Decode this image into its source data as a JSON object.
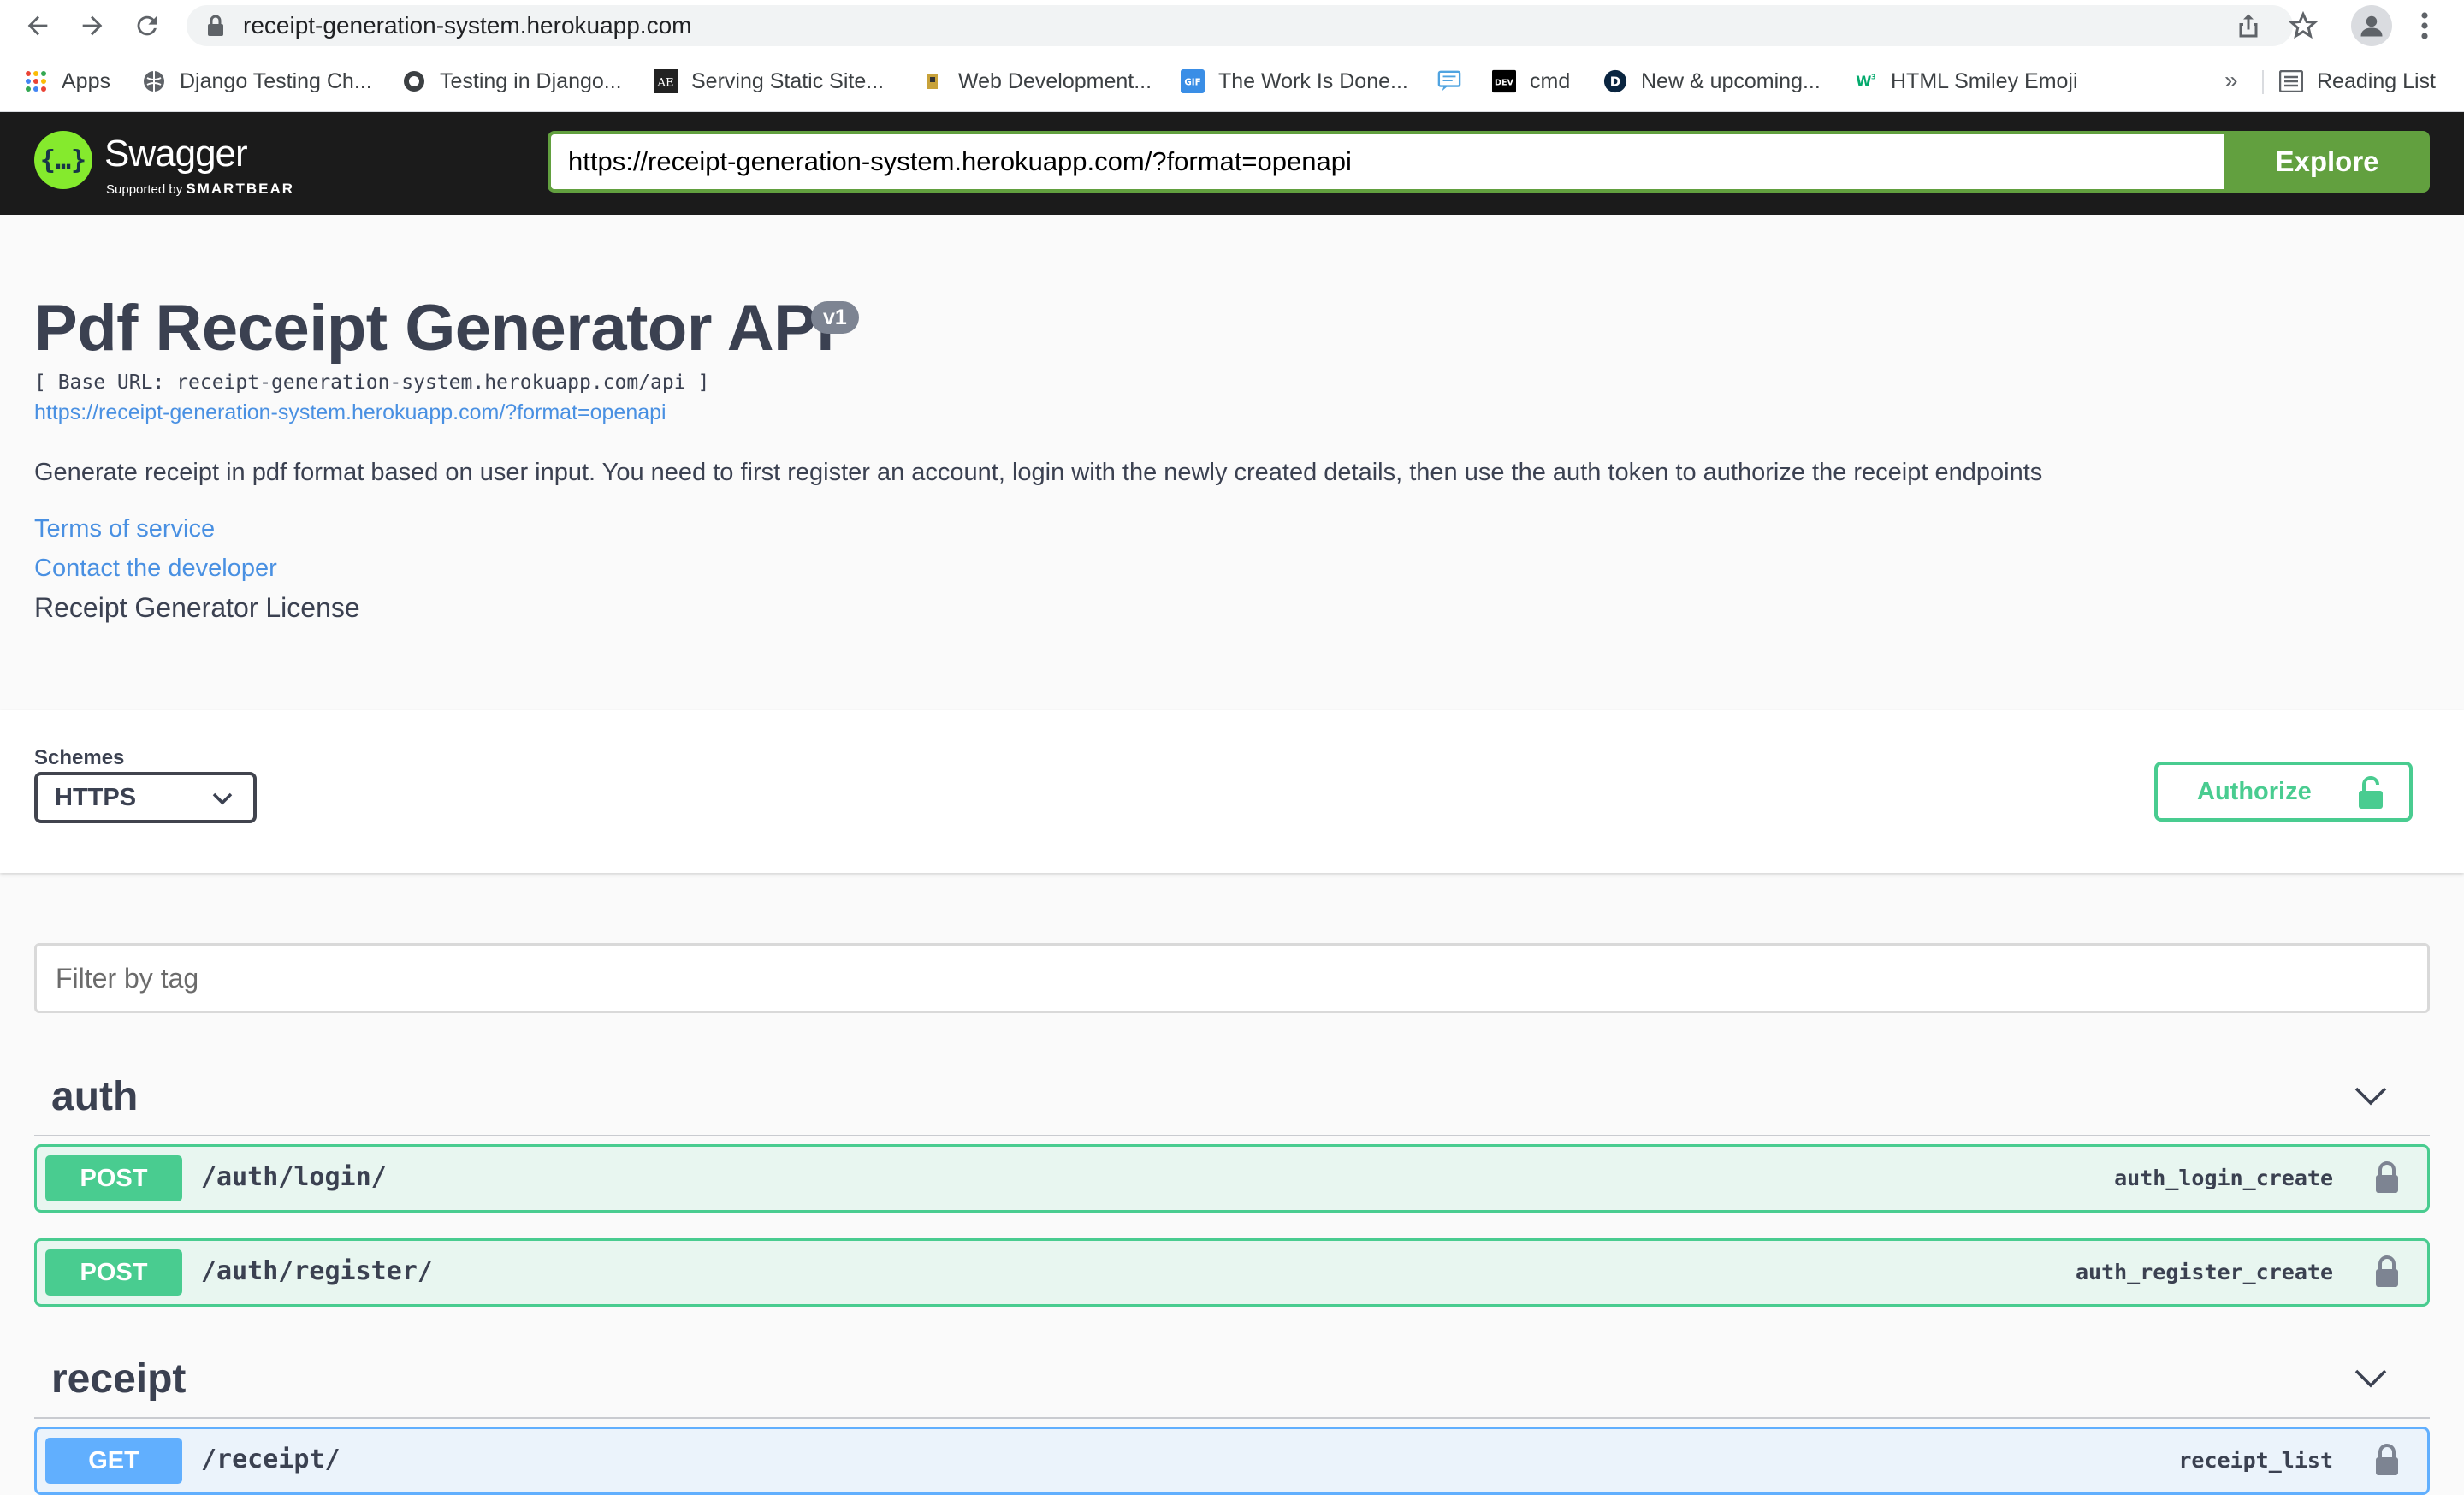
{
  "browser": {
    "url": "receipt-generation-system.herokuapp.com",
    "bookmarks": [
      {
        "label": "Apps",
        "icon": "apps-grid-icon"
      },
      {
        "label": "Django Testing Ch...",
        "icon": "globe-icon"
      },
      {
        "label": "Testing in Django...",
        "icon": "python-icon"
      },
      {
        "label": "Serving Static Site...",
        "icon": "ae-icon"
      },
      {
        "label": "Web Development...",
        "icon": "bookmark-favicon"
      },
      {
        "label": "The Work Is Done...",
        "icon": "gif-icon"
      },
      {
        "label": "",
        "icon": "chat-icon"
      },
      {
        "label": "cmd",
        "icon": "dev-icon"
      },
      {
        "label": "New & upcoming...",
        "icon": "d-logo-icon"
      },
      {
        "label": "HTML Smiley Emoji",
        "icon": "w3-icon"
      }
    ],
    "more": "»",
    "reading_list": "Reading List"
  },
  "topbar": {
    "logo_name": "Swagger",
    "logo_sub_prefix": "Supported by",
    "logo_sub_brand": "SMARTBEAR",
    "spec_url": "https://receipt-generation-system.herokuapp.com/?format=openapi",
    "explore_label": "Explore"
  },
  "info": {
    "title": "Pdf Receipt Generator API",
    "version": "v1",
    "base_url": "[ Base URL: receipt-generation-system.herokuapp.com/api ]",
    "spec_link": "https://receipt-generation-system.herokuapp.com/?format=openapi",
    "description": "Generate receipt in pdf format based on user input. You need to first register an account, login with the newly created details, then use the auth token to authorize the receipt endpoints",
    "terms": "Terms of service",
    "contact": "Contact the developer",
    "license": "Receipt Generator License"
  },
  "schemes": {
    "label": "Schemes",
    "selected": "HTTPS",
    "authorize_label": "Authorize"
  },
  "filter": {
    "placeholder": "Filter by tag"
  },
  "tags": [
    {
      "name": "auth",
      "operations": [
        {
          "method": "POST",
          "path": "/auth/login/",
          "operation_id": "auth_login_create"
        },
        {
          "method": "POST",
          "path": "/auth/register/",
          "operation_id": "auth_register_create"
        }
      ]
    },
    {
      "name": "receipt",
      "operations": [
        {
          "method": "GET",
          "path": "/receipt/",
          "operation_id": "receipt_list"
        }
      ]
    }
  ],
  "colors": {
    "post": "#49cc90",
    "get": "#61affe",
    "explore": "#62a03f",
    "link": "#4990e2",
    "topbar": "#1b1b1b"
  }
}
